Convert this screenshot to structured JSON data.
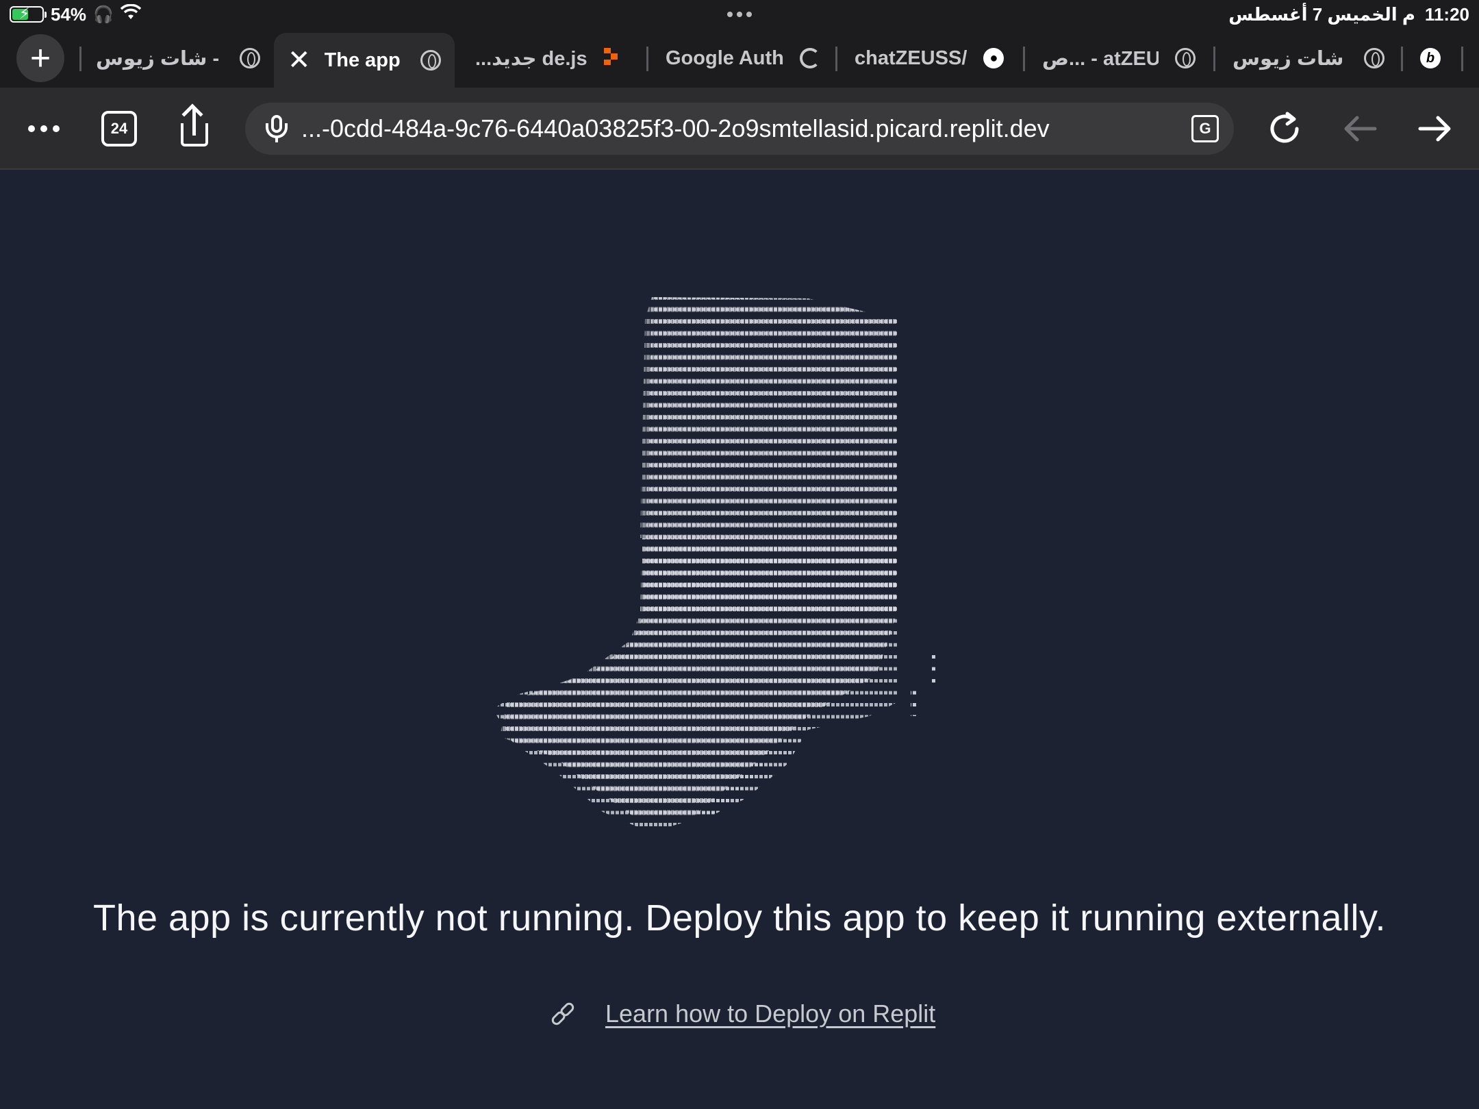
{
  "status_bar": {
    "battery_percent": "54%",
    "battery_level": 0.54,
    "time": "11:20",
    "date_ar": "م  الخميس 7 أغسطس"
  },
  "tabs": [
    {
      "label": "شات زيوس - !",
      "icon": "globe-icon",
      "active": false
    },
    {
      "label": "The app",
      "icon": "globe-icon",
      "active": true
    },
    {
      "label": "...جديد de.js",
      "icon": "replit-icon",
      "active": false
    },
    {
      "label": "Google Auth",
      "icon": "google-icon",
      "active": false
    },
    {
      "label": "chatZEUSS/",
      "icon": "github-icon",
      "active": false
    },
    {
      "label": "ص... - atZEUS",
      "icon": "globe-icon",
      "active": false
    },
    {
      "label": "شات زيوس - !",
      "icon": "globe-icon",
      "active": false
    },
    {
      "label": "b",
      "icon": "b-icon",
      "active": false
    }
  ],
  "toolbar": {
    "tab_count": "24",
    "url": "...-0cdd-484a-9c76-6440a03825f3-00-2o9smtellasid.picard.replit.dev"
  },
  "page": {
    "message": "The app is currently not running. Deploy this app to keep it running externally.",
    "link_text": "Learn how to Deploy on Replit"
  },
  "colors": {
    "page_background": "#1c2231",
    "browser_chrome": "#1c1c1e",
    "toolbar": "#2c2c2e",
    "accent_replit": "#f26207"
  }
}
